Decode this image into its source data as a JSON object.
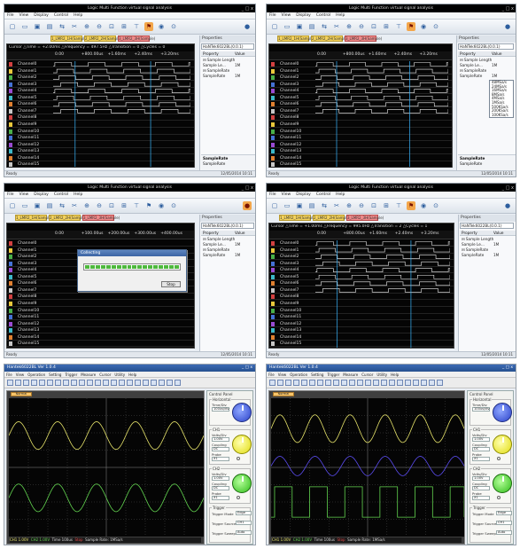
{
  "la_app_title": "Logic Multi Function virtual signal analysis",
  "la_window_controls": "_ □ x",
  "la_menu": [
    "File",
    "View",
    "Display",
    "Control",
    "Help"
  ],
  "la_toolbar_icons": [
    "new-icon",
    "open-icon",
    "save-icon",
    "print-icon",
    "connect-icon",
    "cut-icon",
    "zoom-in-icon",
    "zoom-out-icon",
    "zoom-fit-icon",
    "zoom-all-icon",
    "cursor-icon",
    "trigger-icon",
    "marker-icon",
    "capture-icon",
    "run-icon"
  ],
  "la_tabs": [
    "1_LMR2_1H(Sample)",
    "2_LMR2_2H(Sample)",
    "3_LMR2_3H(Sample)"
  ],
  "la_channels": [
    "Channel0",
    "Channel1",
    "Channel2",
    "Channel3",
    "Channel4",
    "Channel5",
    "Channel6",
    "Channel7",
    "Channel8",
    "Channel9",
    "Channel10",
    "Channel11",
    "Channel12",
    "Channel13",
    "Channel14",
    "Channel15"
  ],
  "la_channel_colors": [
    "#d24040",
    "#e9c83b",
    "#49b049",
    "#4472d6",
    "#9a4bd2",
    "#3cb8c8",
    "#e08030",
    "#c7c7c7",
    "#d24040",
    "#e9c83b",
    "#49b049",
    "#4472d6",
    "#9a4bd2",
    "#3cb8c8",
    "#e08030",
    "#c7c7c7"
  ],
  "la_ticks_a": [
    "0.00",
    "+800.00us",
    "+1.60ms",
    "+2.40ms",
    "+3.20ms"
  ],
  "la_ticks_b": [
    "0.00",
    "+100.00us",
    "+200.00us",
    "+300.00us",
    "+400.00us"
  ],
  "la_ticks_c": [
    "0.00",
    "+800.00us",
    "+1.60ms",
    "+2.40ms",
    "+3.20ms"
  ],
  "la_cursor_a": "Cursor  △Time = +2.00ms  △Frequency = 497.5Hz  △Transition = 0  △Cycles = 0",
  "la_cursor_c": "Cursor  △Time = +1.00ms  △Frequency = 995.0Hz  △Transition = 2  △Cycles = 1",
  "la_side_header": "Properties",
  "la_device": "HaNTek6022BL(0.0.1)",
  "la_prop_header_key": "Property",
  "la_prop_header_val": "Value",
  "la_props": [
    {
      "key": "⊟ Sample Length",
      "val": ""
    },
    {
      "key": "   Sample Le...",
      "val": "1M"
    },
    {
      "key": "⊟ SampleRate",
      "val": ""
    },
    {
      "key": "   SampleRate",
      "val": "1M"
    }
  ],
  "la_samplerate_options": [
    "48MSa/s",
    "24MSa/s",
    "16MSa/s",
    "8MSa/s",
    "4MSa/s",
    "1MSa/s",
    "500KSa/s",
    "200KSa/s",
    "100KSa/s"
  ],
  "la_desc_title": "SampleRate",
  "la_desc_text": "SampleRate",
  "la_status_left": "Ready",
  "la_status_right": "12/05/2014 10:11",
  "la_dialog_title": "Collecting",
  "la_dialog_button": "Stop",
  "la_progress_segments": 18,
  "sc_app_title": "Hantek6022BL  Ver 1.0.4",
  "sc_window_controls": "_ □ x",
  "sc_menu": [
    "File",
    "View",
    "Operation",
    "Setting",
    "Trigger",
    "Measure",
    "Cursor",
    "Utility",
    "Help"
  ],
  "sc_area_tab": "Normal",
  "sc_status_1": {
    "ch1": "CH1 1.00V",
    "ch2": "CH2 1.00V",
    "mid": "Time 100us",
    "ch3": "Stop",
    "right": "Sample Rate: 1MSa/s"
  },
  "sc_status_2": {
    "ch1": "CH1 1.00V",
    "ch2": "CH2 1.00V",
    "mid": "Time 100us",
    "ch3": "Stop",
    "right": "Sample Rate: 1MSa/s"
  },
  "sc_panel_title": "Control Panel",
  "sc_groups": {
    "horizontal": "Horizontal",
    "ch1": "CH1",
    "ch2": "CH2",
    "trigger": "Trigger"
  },
  "sc_fields": {
    "timebase": "100us/div",
    "ch1_volts": "1.00V",
    "ch1_coupling": "DC",
    "ch1_probe": "X1",
    "ch2_volts": "1.00V",
    "ch2_coupling": "DC",
    "ch2_probe": "X1",
    "trig_mode": "Edge",
    "trig_source": "CH1",
    "trig_sweep": "Auto"
  },
  "sc_labels": {
    "timebase": "Time/Div",
    "volts": "Volts/Div",
    "coupling": "Coupling",
    "probe": "Probe",
    "trig_mode": "Trigger Mode",
    "trig_source": "Trigger Source",
    "trig_sweep": "Trigger Sweep"
  },
  "sc_ch_colors": {
    "ch1": "#e6e36a",
    "ch2": "#62d34f",
    "ch3": "#5b4cf0"
  }
}
